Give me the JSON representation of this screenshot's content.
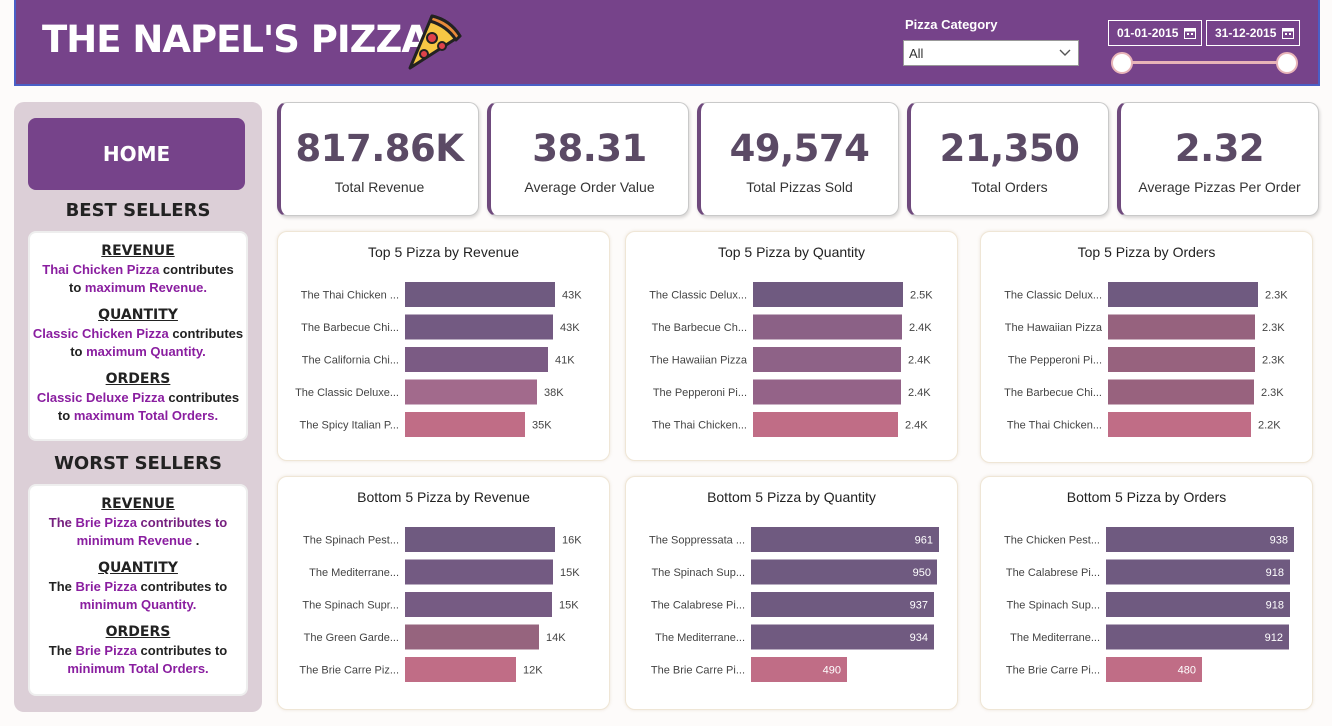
{
  "header": {
    "title": "THE NAPEL'S PIZZA",
    "category_label": "Pizza Category",
    "category_value": "All",
    "date_start": "01-01-2015",
    "date_end": "31-12-2015",
    "colors": {
      "bg": "#76438a",
      "accent": "#e8b4b8"
    }
  },
  "sidebar": {
    "home_label": "HOME",
    "best_heading": "BEST SELLERS",
    "worst_heading": "WORST SELLERS",
    "best": [
      {
        "title": "REVENUE",
        "pizza": "Thai Chicken Pizza",
        "mid": " contributes",
        "line2_pre": "to ",
        "line2_hl": "maximum Revenue.",
        "line2_post": ""
      },
      {
        "title": "QUANTITY",
        "pizza": "Classic Chicken Pizza",
        "mid": " contributes",
        "line2_pre": "to ",
        "line2_hl": "maximum Quantity.",
        "line2_post": ""
      },
      {
        "title": "ORDERS",
        "pizza": "Classic Deluxe Pizza",
        "mid": " contributes",
        "line2_pre": "to ",
        "line2_hl": "maximum Total Orders.",
        "line2_post": ""
      }
    ],
    "worst": [
      {
        "title": "REVENUE",
        "pre": "The ",
        "pizza": "Brie Pizza",
        "mid": " contributes to",
        "line2_hl": "minimum Revenue",
        "line2_post": " ."
      },
      {
        "title": "QUANTITY",
        "pre": "The ",
        "pizza": "Brie Pizza",
        "mid": " contributes to",
        "line2_hl": "minimum Quantity.",
        "line2_post": ""
      },
      {
        "title": "ORDERS",
        "pre": "The ",
        "pizza": "Brie Pizza",
        "mid": " contributes to",
        "line2_hl": "minimum Total Orders.",
        "line2_post": ""
      }
    ]
  },
  "kpis": [
    {
      "value": "817.86K",
      "label": "Total Revenue"
    },
    {
      "value": "38.31",
      "label": "Average Order Value"
    },
    {
      "value": "49,574",
      "label": "Total Pizzas Sold"
    },
    {
      "value": "21,350",
      "label": "Total Orders"
    },
    {
      "value": "2.32",
      "label": "Average Pizzas Per Order"
    }
  ],
  "chart_data": [
    {
      "type": "bar",
      "orientation": "horizontal",
      "title": "Top 5 Pizza by Revenue",
      "categories": [
        "The Thai Chicken ...",
        "The Barbecue Chi...",
        "The California Chi...",
        "The Classic Deluxe...",
        "The Spicy Italian P..."
      ],
      "values": [
        43434,
        42768,
        41410,
        38180,
        34832
      ],
      "data_labels": [
        "43K",
        "43K",
        "41K",
        "38K",
        "35K"
      ],
      "labels_inside": false,
      "colors": [
        "#6f5a80",
        "#735a82",
        "#7b5b84",
        "#a26a8c",
        "#c06d86"
      ]
    },
    {
      "type": "bar",
      "orientation": "horizontal",
      "title": "Top 5 Pizza by Quantity",
      "categories": [
        "The Classic Delux...",
        "The Barbecue Ch...",
        "The Hawaiian Pizza",
        "The Pepperoni Pi...",
        "The Thai Chicken..."
      ],
      "values": [
        2453,
        2432,
        2422,
        2418,
        2371
      ],
      "data_labels": [
        "2.5K",
        "2.4K",
        "2.4K",
        "2.4K",
        "2.4K"
      ],
      "labels_inside": false,
      "colors": [
        "#6f5a80",
        "#8b6186",
        "#8e6287",
        "#946388",
        "#c06d86"
      ]
    },
    {
      "type": "bar",
      "orientation": "horizontal",
      "title": "Top 5 Pizza by Orders",
      "categories": [
        "The Classic Delux...",
        "The Hawaiian Pizza",
        "The Pepperoni Pi...",
        "The Barbecue Chi...",
        "The Thai Chicken..."
      ],
      "values": [
        2329,
        2280,
        2278,
        2273,
        2225
      ],
      "data_labels": [
        "2.3K",
        "2.3K",
        "2.3K",
        "2.3K",
        "2.2K"
      ],
      "labels_inside": false,
      "colors": [
        "#6f5a80",
        "#96627e",
        "#97627e",
        "#98627e",
        "#c06d86"
      ]
    },
    {
      "type": "bar",
      "orientation": "horizontal",
      "title": "Bottom 5 Pizza by Revenue",
      "categories": [
        "The Spinach Pest...",
        "The Mediterrane...",
        "The Spinach Supr...",
        "The Green Garde...",
        "The Brie Carre Piz..."
      ],
      "values": [
        15596,
        15360,
        15278,
        13956,
        11588
      ],
      "data_labels": [
        "16K",
        "15K",
        "15K",
        "14K",
        "12K"
      ],
      "labels_inside": false,
      "colors": [
        "#6f5a80",
        "#735a82",
        "#765b83",
        "#96647e",
        "#c06d86"
      ]
    },
    {
      "type": "bar",
      "orientation": "horizontal",
      "title": "Bottom 5 Pizza by Quantity",
      "categories": [
        "The Soppressata ...",
        "The Spinach Sup...",
        "The Calabrese Pi...",
        "The Mediterrane...",
        "The Brie Carre Pi..."
      ],
      "values": [
        961,
        950,
        937,
        934,
        490
      ],
      "data_labels": [
        "961",
        "950",
        "937",
        "934",
        "490"
      ],
      "labels_inside": true,
      "colors": [
        "#6f5a80",
        "#6f5a80",
        "#6f5a80",
        "#705a80",
        "#c06d86"
      ]
    },
    {
      "type": "bar",
      "orientation": "horizontal",
      "title": "Bottom 5 Pizza by Orders",
      "categories": [
        "The Chicken Pest...",
        "The Calabrese Pi...",
        "The Spinach Sup...",
        "The Mediterrane...",
        "The Brie Carre Pi..."
      ],
      "values": [
        938,
        918,
        918,
        912,
        480
      ],
      "data_labels": [
        "938",
        "918",
        "918",
        "912",
        "480"
      ],
      "labels_inside": true,
      "colors": [
        "#6f5a80",
        "#6f5a80",
        "#6f5a80",
        "#705a80",
        "#c06d86"
      ]
    }
  ]
}
